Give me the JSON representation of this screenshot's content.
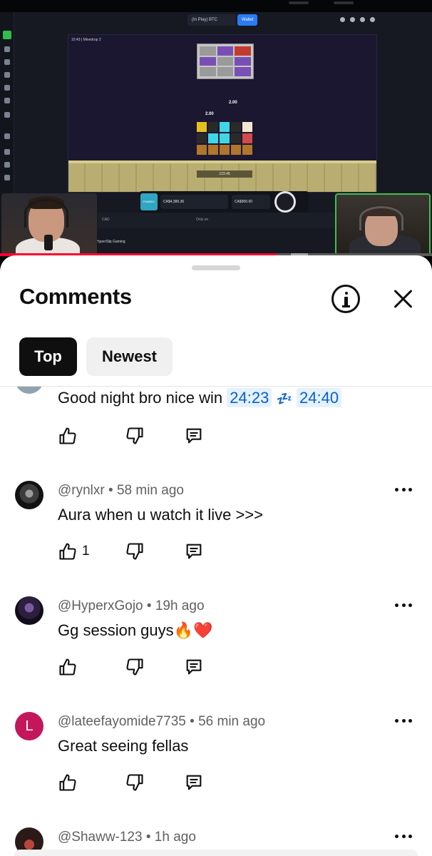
{
  "video": {
    "balance_label": "(In Play) BTC",
    "wallet_label": "Wallet",
    "game_title": "10:43 | Minedrop 2",
    "multiplier_a": "2.00",
    "multiplier_b": "2.00",
    "game_label": "123.45",
    "bet_button": "ENABLE",
    "bet_field_one": "CA$4,386.36",
    "bet_field_two": "CA$900.00",
    "currency": "CAD",
    "lower_bar_label": "Only on",
    "caption": "HyperSlip Gaming",
    "progress_fraction": 0.64,
    "buffer_fraction": 0.68
  },
  "comments_panel": {
    "title": "Comments",
    "info_icon": "info-icon",
    "close_icon": "close-icon",
    "filters": [
      {
        "label": "Top",
        "selected": true
      },
      {
        "label": "Newest",
        "selected": false
      }
    ],
    "comments": [
      {
        "author": "",
        "time": "",
        "text_parts": [
          "Good night bro nice win",
          "24:23",
          "💤",
          "24:40"
        ],
        "likes": ""
      },
      {
        "author": "@rynlxr",
        "time": "58 min ago",
        "text": "Aura when u watch it live >>>",
        "likes": "1"
      },
      {
        "author": "@HyperxGojo",
        "time": "19h ago",
        "text": "Gg session guys🔥❤️",
        "likes": ""
      },
      {
        "author": "@lateefayomide7735",
        "time": "56 min ago",
        "text": "Great seeing fellas",
        "likes": "",
        "avatar_letter": "L"
      },
      {
        "author": "@Shaww-123",
        "time": "1h ago",
        "text": "",
        "likes": ""
      }
    ]
  },
  "colors": {
    "accent_red": "#ff0033",
    "timestamp_blue": "#065fd4",
    "chip_selected": "#0f0f0f",
    "avatar_letter_bg": "#c2185b"
  }
}
